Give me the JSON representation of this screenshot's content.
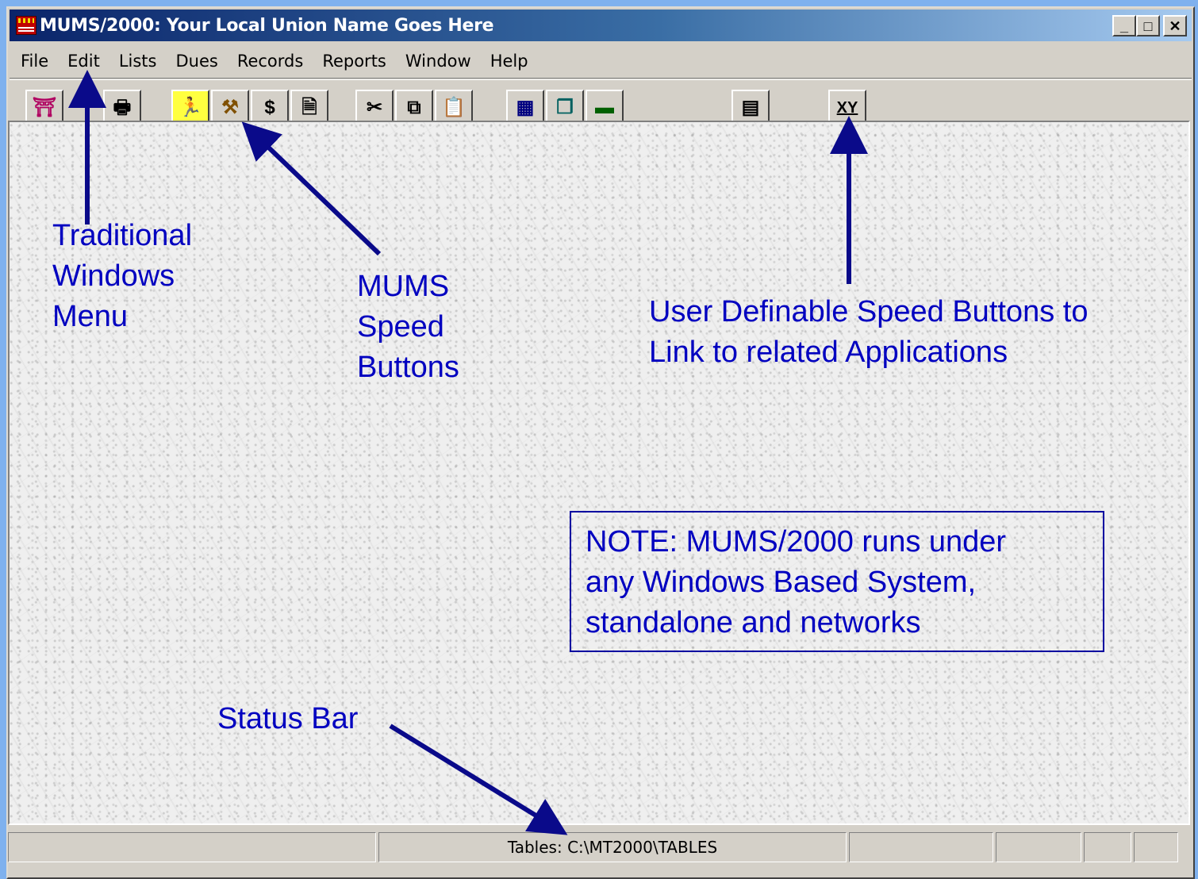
{
  "window": {
    "title": "MUMS/2000: Your Local Union Name Goes Here",
    "minimize_glyph": "_",
    "maximize_glyph": "□",
    "close_glyph": "✕"
  },
  "menu": {
    "items": [
      {
        "label": "File"
      },
      {
        "label": "Edit"
      },
      {
        "label": "Lists"
      },
      {
        "label": "Dues"
      },
      {
        "label": "Records"
      },
      {
        "label": "Reports"
      },
      {
        "label": "Window"
      },
      {
        "label": "Help"
      }
    ]
  },
  "toolbar": {
    "buttons": [
      {
        "icon": "exit-door-icon",
        "glyph": "⛩"
      },
      {
        "icon": "printer-icon",
        "glyph": "🖶"
      },
      {
        "icon": "member-icon",
        "glyph": "🏃"
      },
      {
        "icon": "members-group-icon",
        "glyph": "⚒"
      },
      {
        "icon": "dollar-icon",
        "glyph": "$"
      },
      {
        "icon": "document-icon",
        "glyph": "🗎"
      },
      {
        "icon": "scissors-icon",
        "glyph": "✂"
      },
      {
        "icon": "copy-icon",
        "glyph": "⧉"
      },
      {
        "icon": "paste-icon",
        "glyph": "📋"
      },
      {
        "icon": "table-grid-icon",
        "glyph": "▦"
      },
      {
        "icon": "window-cascade-icon",
        "glyph": "❐"
      },
      {
        "icon": "window-minimized-icon",
        "glyph": "▬"
      },
      {
        "icon": "calculator-icon",
        "glyph": "▤"
      },
      {
        "icon": "xy-icon",
        "glyph": "XY"
      }
    ]
  },
  "annotations": {
    "menu_callout": [
      "Traditional",
      "Windows",
      "Menu"
    ],
    "speed_callout": [
      "MUMS",
      "Speed",
      "Buttons"
    ],
    "user_callout": [
      "User Definable Speed Buttons to",
      "Link to related Applications"
    ],
    "status_callout": "Status Bar",
    "note": [
      "NOTE:  MUMS/2000 runs under",
      "any Windows Based System,",
      "standalone and networks"
    ],
    "arrow_color": "#0a0a8a"
  },
  "statusbar": {
    "tables_path": "Tables: C:\\MT2000\\TABLES"
  }
}
